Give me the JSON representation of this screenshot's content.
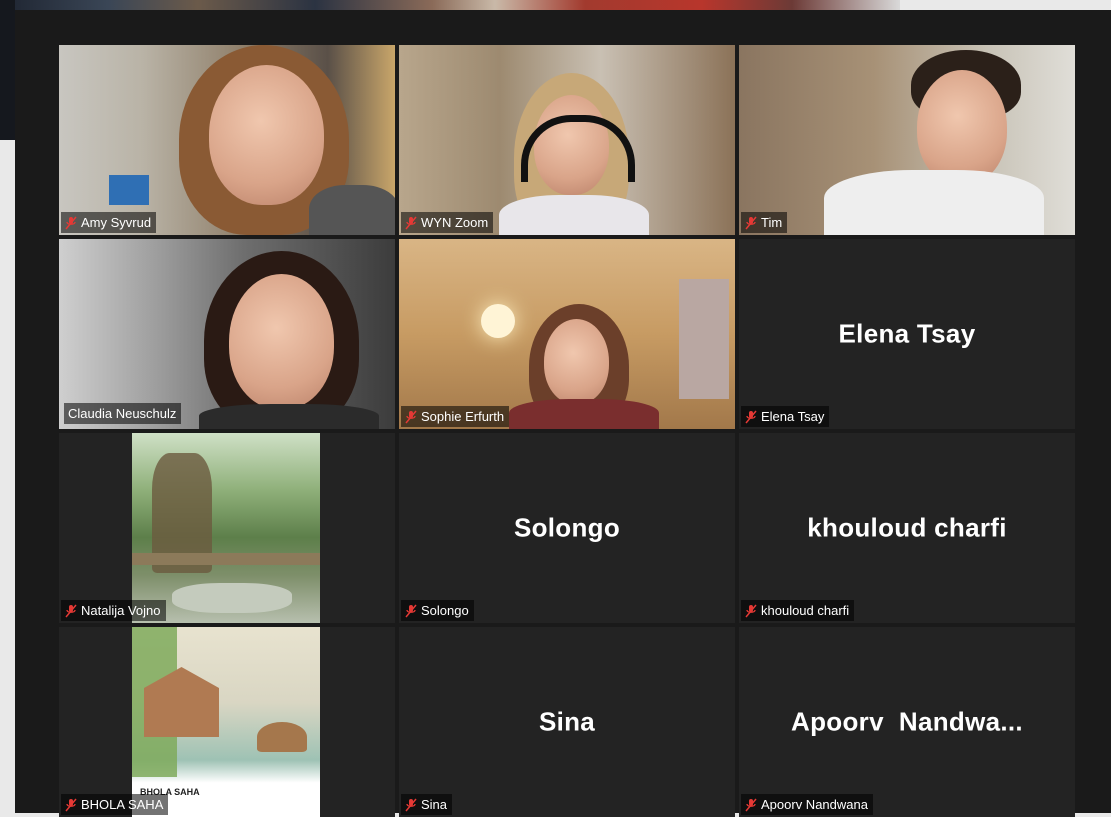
{
  "participants": [
    {
      "name": "Amy Syvrud",
      "muted": true,
      "video": true
    },
    {
      "name": "WYN Zoom",
      "muted": true,
      "video": true
    },
    {
      "name": "Tim",
      "muted": true,
      "video": true
    },
    {
      "name": "Claudia Neuschulz",
      "muted": false,
      "video": true,
      "active_speaker": true
    },
    {
      "name": "Sophie Erfurth",
      "muted": true,
      "video": true
    },
    {
      "name": "Elena Tsay",
      "display": "Elena Tsay",
      "muted": true,
      "video": false
    },
    {
      "name": "Natalija Vojno",
      "muted": true,
      "video": true
    },
    {
      "name": "Solongo",
      "display": "Solongo",
      "muted": true,
      "video": false
    },
    {
      "name": "khouloud charfi",
      "display": "khouloud charfi",
      "muted": true,
      "video": false
    },
    {
      "name": "BHOLA SAHA",
      "muted": true,
      "video": true
    },
    {
      "name": "Sina",
      "display": "Sina",
      "muted": true,
      "video": false
    },
    {
      "name": "Apoorv Nandwana",
      "display": "Apoorv  Nandwa...",
      "muted": true,
      "video": false
    }
  ],
  "book_cover": {
    "author": "BHOLA SAHA"
  },
  "colors": {
    "active_border": "#d4e157",
    "muted_icon": "#e53935",
    "tile_bg": "#232323"
  },
  "icons": {
    "muted": "mic-muted-icon"
  }
}
